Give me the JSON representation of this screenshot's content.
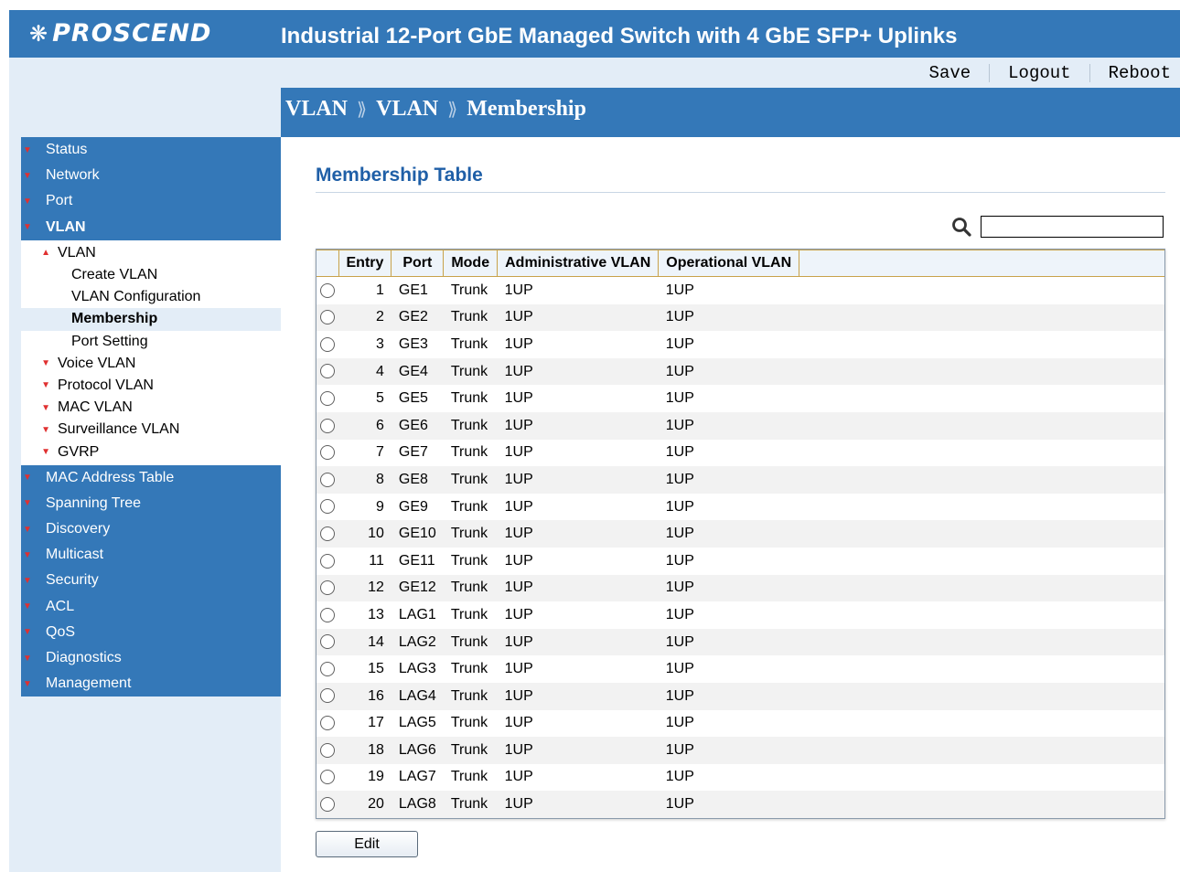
{
  "header": {
    "logo": "PROSCEND",
    "title": "Industrial 12-Port GbE Managed Switch with 4 GbE SFP+ Uplinks",
    "colors": {
      "bar": "#3478b8",
      "text": "#ffffff"
    }
  },
  "toolbar": {
    "save": "Save",
    "logout": "Logout",
    "reboot": "Reboot"
  },
  "breadcrumb": {
    "items": [
      "VLAN",
      "VLAN",
      "Membership"
    ]
  },
  "sidebar": {
    "main_top": [
      {
        "label": "Status"
      },
      {
        "label": "Network"
      },
      {
        "label": "Port"
      },
      {
        "label": "VLAN",
        "active": true
      }
    ],
    "vlan_sub": {
      "label": "VLAN",
      "items": [
        "Create VLAN",
        "VLAN Configuration",
        "Membership",
        "Port Setting"
      ],
      "active_item": "Membership"
    },
    "vlan_other": [
      "Voice VLAN",
      "Protocol VLAN",
      "MAC VLAN",
      "Surveillance VLAN",
      "GVRP"
    ],
    "main_bottom": [
      "MAC Address Table",
      "Spanning Tree",
      "Discovery",
      "Multicast",
      "Security",
      "ACL",
      "QoS",
      "Diagnostics",
      "Management"
    ]
  },
  "main": {
    "section_title": "Membership Table",
    "search": {
      "value": "",
      "icon": "search-icon"
    },
    "columns": [
      "",
      "Entry",
      "Port",
      "Mode",
      "Administrative VLAN",
      "Operational VLAN",
      ""
    ],
    "rows": [
      {
        "entry": "1",
        "port": "GE1",
        "mode": "Trunk",
        "admin": "1UP",
        "oper": "1UP"
      },
      {
        "entry": "2",
        "port": "GE2",
        "mode": "Trunk",
        "admin": "1UP",
        "oper": "1UP"
      },
      {
        "entry": "3",
        "port": "GE3",
        "mode": "Trunk",
        "admin": "1UP",
        "oper": "1UP"
      },
      {
        "entry": "4",
        "port": "GE4",
        "mode": "Trunk",
        "admin": "1UP",
        "oper": "1UP"
      },
      {
        "entry": "5",
        "port": "GE5",
        "mode": "Trunk",
        "admin": "1UP",
        "oper": "1UP"
      },
      {
        "entry": "6",
        "port": "GE6",
        "mode": "Trunk",
        "admin": "1UP",
        "oper": "1UP"
      },
      {
        "entry": "7",
        "port": "GE7",
        "mode": "Trunk",
        "admin": "1UP",
        "oper": "1UP"
      },
      {
        "entry": "8",
        "port": "GE8",
        "mode": "Trunk",
        "admin": "1UP",
        "oper": "1UP"
      },
      {
        "entry": "9",
        "port": "GE9",
        "mode": "Trunk",
        "admin": "1UP",
        "oper": "1UP"
      },
      {
        "entry": "10",
        "port": "GE10",
        "mode": "Trunk",
        "admin": "1UP",
        "oper": "1UP"
      },
      {
        "entry": "11",
        "port": "GE11",
        "mode": "Trunk",
        "admin": "1UP",
        "oper": "1UP"
      },
      {
        "entry": "12",
        "port": "GE12",
        "mode": "Trunk",
        "admin": "1UP",
        "oper": "1UP"
      },
      {
        "entry": "13",
        "port": "LAG1",
        "mode": "Trunk",
        "admin": "1UP",
        "oper": "1UP"
      },
      {
        "entry": "14",
        "port": "LAG2",
        "mode": "Trunk",
        "admin": "1UP",
        "oper": "1UP"
      },
      {
        "entry": "15",
        "port": "LAG3",
        "mode": "Trunk",
        "admin": "1UP",
        "oper": "1UP"
      },
      {
        "entry": "16",
        "port": "LAG4",
        "mode": "Trunk",
        "admin": "1UP",
        "oper": "1UP"
      },
      {
        "entry": "17",
        "port": "LAG5",
        "mode": "Trunk",
        "admin": "1UP",
        "oper": "1UP"
      },
      {
        "entry": "18",
        "port": "LAG6",
        "mode": "Trunk",
        "admin": "1UP",
        "oper": "1UP"
      },
      {
        "entry": "19",
        "port": "LAG7",
        "mode": "Trunk",
        "admin": "1UP",
        "oper": "1UP"
      },
      {
        "entry": "20",
        "port": "LAG8",
        "mode": "Trunk",
        "admin": "1UP",
        "oper": "1UP"
      }
    ],
    "edit_label": "Edit"
  }
}
